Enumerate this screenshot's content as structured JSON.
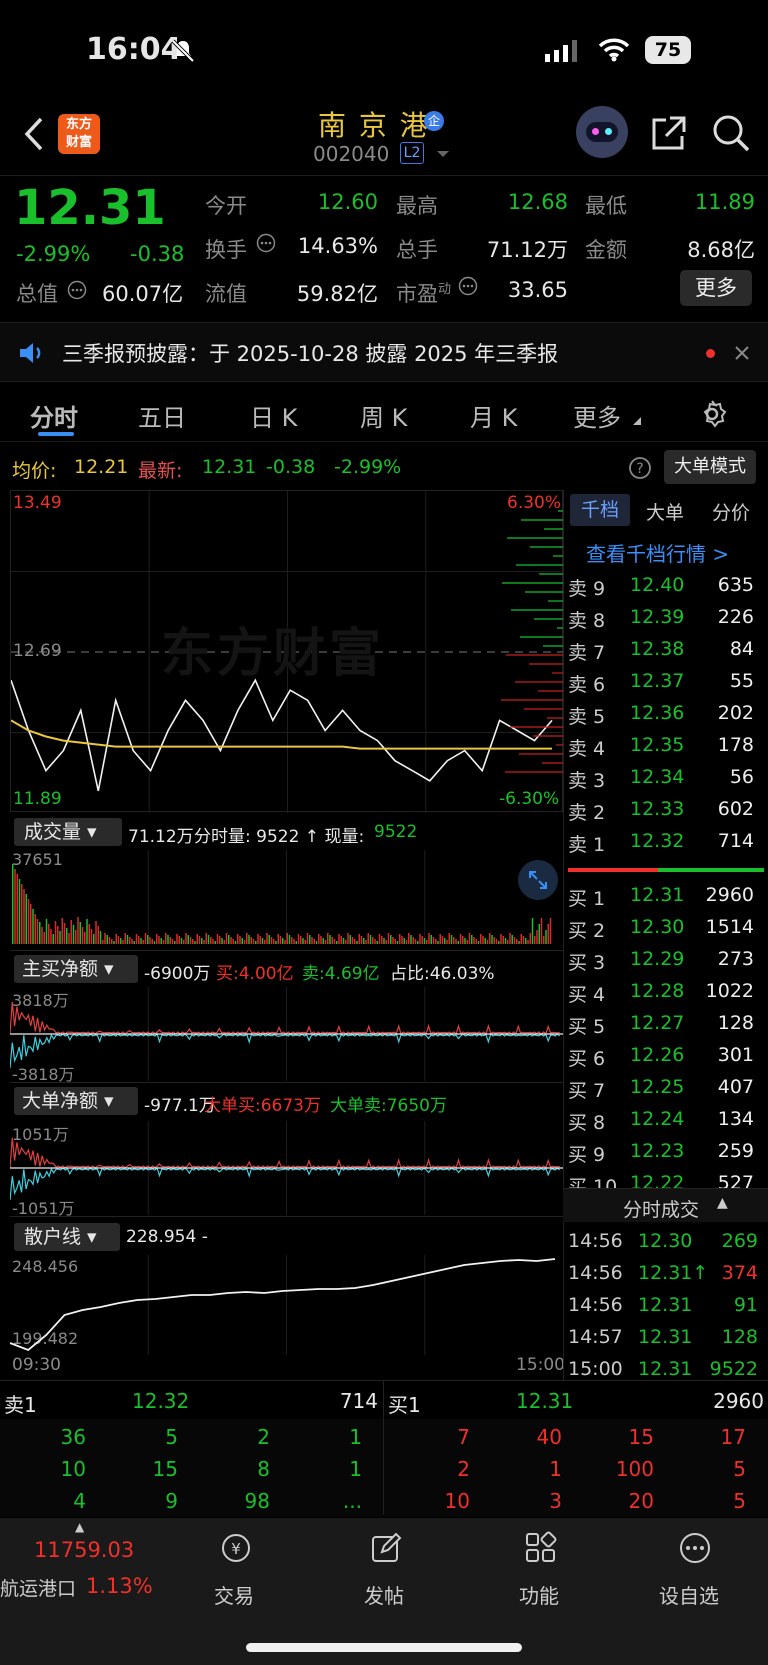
{
  "status": {
    "time": "16:04",
    "battery": "75"
  },
  "header": {
    "title": "南 京 港",
    "code": "002040",
    "level": "L2",
    "logo_line1": "东方",
    "logo_line2": "财富",
    "badge": "企"
  },
  "quote": {
    "price": "12.31",
    "pct": "-2.99%",
    "chg": "-0.38",
    "open_label": "今开",
    "open": "12.60",
    "high_label": "最高",
    "high": "12.68",
    "low_label": "最低",
    "low": "11.89",
    "turnover_label": "换手",
    "turnover": "14.63%",
    "vol_label": "总手",
    "vol": "71.12万",
    "amt_label": "金额",
    "amt": "8.68亿",
    "mcap_label": "总值",
    "mcap": "60.07亿",
    "float_label": "流值",
    "float": "59.82亿",
    "pe_label": "市盈",
    "pe_sup": "动",
    "pe": "33.65",
    "more": "更多"
  },
  "notice": {
    "text": "三季报预披露：于 2025-10-28 披露 2025 年三季报"
  },
  "tabs": [
    "分时",
    "五日",
    "日 K",
    "周 K",
    "月 K",
    "更多"
  ],
  "infoline": {
    "avg_label": "均价:",
    "avg": "12.21",
    "latest_label": "最新:",
    "latest": "12.31",
    "chg": "-0.38",
    "pct": "-2.99%",
    "mode": "大单模式"
  },
  "chart": {
    "ymax": "13.49",
    "ymin": "11.89",
    "prev": "12.69",
    "pct_up": "6.30%",
    "pct_dn": "-6.30%",
    "watermark": "东方财富",
    "time_start": "09:30",
    "time_end": "15:00"
  },
  "chart_data": {
    "type": "line",
    "series": [
      {
        "name": "最新",
        "values": [
          12.55,
          12.3,
          12.1,
          12.2,
          12.4,
          12.0,
          12.45,
          12.2,
          12.1,
          12.3,
          12.45,
          12.35,
          12.2,
          12.4,
          12.55,
          12.35,
          12.5,
          12.45,
          12.3,
          12.4,
          12.3,
          12.25,
          12.15,
          12.1,
          12.05,
          12.15,
          12.2,
          12.1,
          12.35,
          12.3,
          12.25,
          12.35
        ]
      },
      {
        "name": "均价",
        "values": [
          12.35,
          12.3,
          12.27,
          12.25,
          12.24,
          12.23,
          12.22,
          12.22,
          12.22,
          12.22,
          12.22,
          12.22,
          12.22,
          12.22,
          12.22,
          12.22,
          12.22,
          12.22,
          12.22,
          12.22,
          12.21,
          12.21,
          12.21,
          12.21,
          12.21,
          12.21,
          12.21,
          12.21,
          12.21,
          12.21,
          12.21,
          12.21
        ]
      }
    ],
    "ylim": [
      11.89,
      13.49
    ]
  },
  "vol": {
    "label": "成交量",
    "total": "71.12万",
    "detail": "分时量: 9522 ↑ 现量:",
    "now": "9522",
    "max": "37651"
  },
  "main": {
    "label": "主买净额",
    "value": "-6900万",
    "buy": "买:4.00亿",
    "sell": "卖:4.69亿",
    "ratio": "占比:46.03%",
    "top": "3818万",
    "bottom": "-3818万"
  },
  "big": {
    "label": "大单净额",
    "value": "-977.1万",
    "buy": "大单买:6673万",
    "sell": "大单卖:7650万",
    "top": "1051万",
    "bottom": "-1051万"
  },
  "retail": {
    "label": "散户线",
    "value": "228.954 -",
    "top": "248.456",
    "bottom": "199.482"
  },
  "side": {
    "tab1": "千档",
    "tab2": "大单",
    "tab3": "分价",
    "link": "查看千档行情 >",
    "asks": [
      [
        "卖 9",
        "12.40",
        "635"
      ],
      [
        "卖 8",
        "12.39",
        "226"
      ],
      [
        "卖 7",
        "12.38",
        "84"
      ],
      [
        "卖 6",
        "12.37",
        "55"
      ],
      [
        "卖 5",
        "12.36",
        "202"
      ],
      [
        "卖 4",
        "12.35",
        "178"
      ],
      [
        "卖 3",
        "12.34",
        "56"
      ],
      [
        "卖 2",
        "12.33",
        "602"
      ],
      [
        "卖 1",
        "12.32",
        "714"
      ]
    ],
    "bids": [
      [
        "买 1",
        "12.31",
        "2960"
      ],
      [
        "买 2",
        "12.30",
        "1514"
      ],
      [
        "买 3",
        "12.29",
        "273"
      ],
      [
        "买 4",
        "12.28",
        "1022"
      ],
      [
        "买 5",
        "12.27",
        "128"
      ],
      [
        "买 6",
        "12.26",
        "301"
      ],
      [
        "买 7",
        "12.25",
        "407"
      ],
      [
        "买 8",
        "12.24",
        "134"
      ],
      [
        "买 9",
        "12.23",
        "259"
      ],
      [
        "买 10",
        "12.22",
        "527"
      ]
    ],
    "trades_title": "分时成交",
    "trades": [
      [
        "14:56",
        "12.30",
        "269"
      ],
      [
        "14:56",
        "12.31↑",
        "374"
      ],
      [
        "14:56",
        "12.31",
        "91"
      ],
      [
        "14:57",
        "12.31",
        "128"
      ],
      [
        "15:00",
        "12.31",
        "9522"
      ]
    ]
  },
  "queue": {
    "sell_label": "卖1",
    "sell_price": "12.32",
    "sell_vol": "714",
    "buy_label": "买1",
    "buy_price": "12.31",
    "buy_vol": "2960",
    "sell_rows": [
      [
        "36",
        "5",
        "2",
        "1"
      ],
      [
        "10",
        "15",
        "8",
        "1"
      ],
      [
        "4",
        "9",
        "98",
        "..."
      ]
    ],
    "buy_rows": [
      [
        "7",
        "40",
        "15",
        "17"
      ],
      [
        "2",
        "1",
        "100",
        "5"
      ],
      [
        "10",
        "3",
        "20",
        "5"
      ]
    ]
  },
  "bottom": {
    "index": "11759.03",
    "index_name": "航运港口",
    "index_pct": "1.13%",
    "trade": "交易",
    "post": "发帖",
    "func": "功能",
    "fav": "设自选"
  }
}
